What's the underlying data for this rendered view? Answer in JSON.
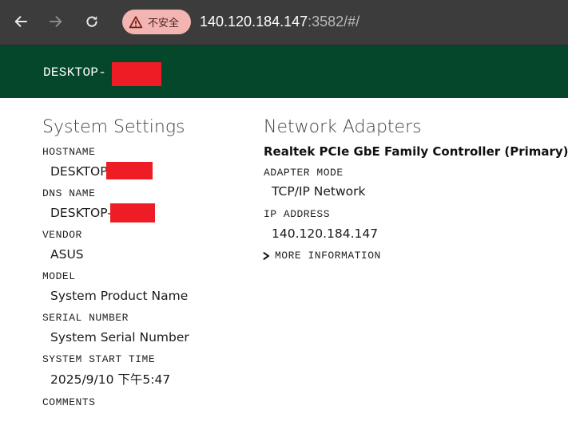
{
  "browser": {
    "security_label": "不安全",
    "url_host": "140.120.184.147",
    "url_rest": ":3582/#/"
  },
  "header": {
    "machine_name": "DESKTOP-          S"
  },
  "system_settings": {
    "title": "System Settings",
    "fields": [
      {
        "label": "HOSTNAME",
        "value": "DESKTOP         S"
      },
      {
        "label": "DNS NAME",
        "value": "DESKTOP-         S"
      },
      {
        "label": "VENDOR",
        "value": "ASUS"
      },
      {
        "label": "MODEL",
        "value": "System Product Name"
      },
      {
        "label": "SERIAL NUMBER",
        "value": "System Serial Number"
      },
      {
        "label": "SYSTEM START TIME",
        "value": "2025/9/10 下午5:47"
      },
      {
        "label": "COMMENTS",
        "value": ""
      }
    ]
  },
  "network_adapters": {
    "title": "Network Adapters",
    "adapter_name": "Realtek PCIe GbE Family Controller (Primary)",
    "fields": [
      {
        "label": "ADAPTER MODE",
        "value": "TCP/IP Network"
      },
      {
        "label": "IP ADDRESS",
        "value": "140.120.184.147"
      }
    ],
    "more_information_label": "MORE INFORMATION"
  }
}
